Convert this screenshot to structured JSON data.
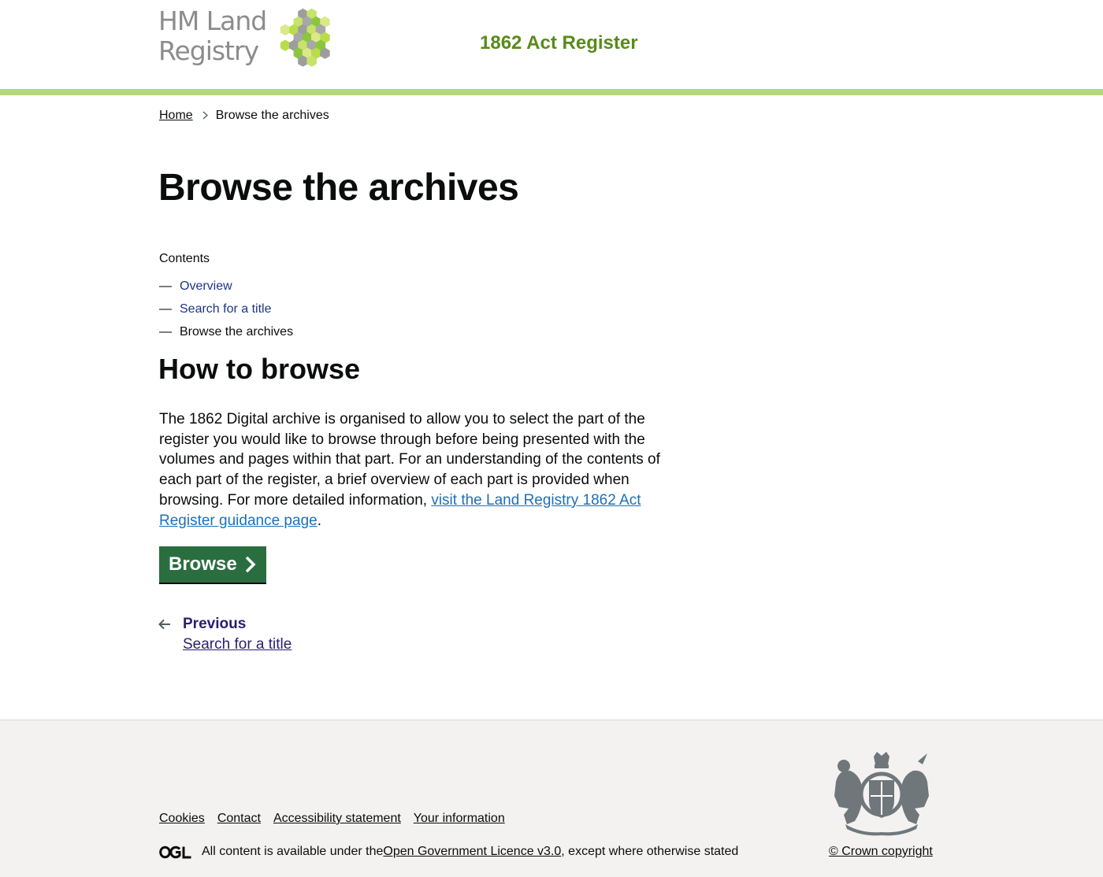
{
  "header": {
    "logo_line1": "HM Land",
    "logo_line2": "Registry",
    "service_name": "1862 Act Register",
    "border_color": "#b4d67c"
  },
  "breadcrumb": {
    "home": "Home",
    "current": "Browse the archives"
  },
  "page_title": "Browse the archives",
  "contents": {
    "label": "Contents",
    "items": [
      {
        "label": "Overview",
        "link": true
      },
      {
        "label": "Search for a title",
        "link": true
      },
      {
        "label": "Browse the archives",
        "link": false
      }
    ]
  },
  "section": {
    "heading": "How to browse",
    "body": "The 1862 Digital archive is organised to allow you to select the part of the register you would like to browse through before being presented with the volumes and pages within that part. For an understanding of the contents of each part of the register, a brief overview of each part is provided when browsing. For more detailed information, ",
    "link_text": "visit the Land Registry 1862 Act Register guidance page",
    "body_end": "."
  },
  "browse_button": {
    "label": "Browse",
    "color": "#2a6e3f"
  },
  "pagination": {
    "previous_title": "Previous",
    "previous_label": "Search for a title"
  },
  "footer": {
    "links": [
      "Cookies",
      "Contact",
      "Accessibility statement",
      "Your information"
    ],
    "licence_prefix": "All content is available under the ",
    "licence_link": "Open Government Licence v3.0",
    "licence_suffix": ", except where otherwise stated",
    "copyright": "© Crown copyright",
    "ogl_logo": "OGL"
  }
}
